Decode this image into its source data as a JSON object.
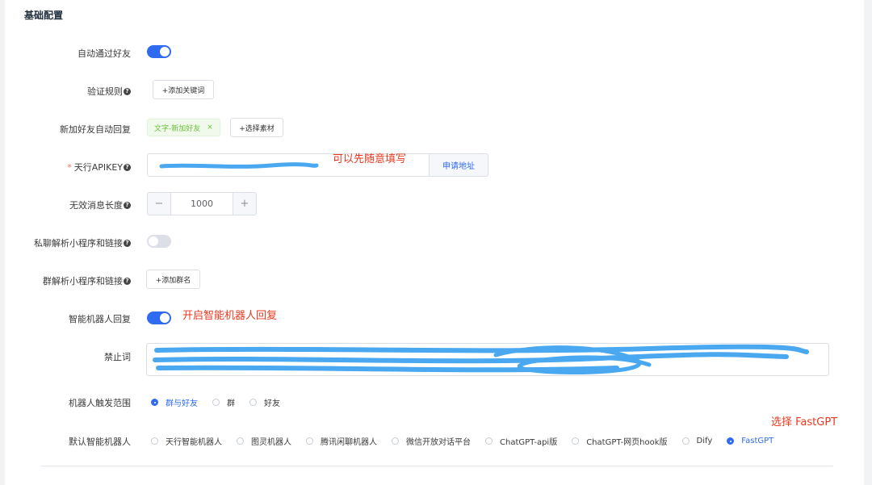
{
  "section_title": "基础配置",
  "auto_accept": {
    "label": "自动通过好友",
    "enabled": true
  },
  "verify_rule": {
    "label": "验证规则",
    "add_button": "+添加关键词"
  },
  "new_friend_reply": {
    "label": "新加好友自动回复",
    "tag": "文字-新加好友",
    "tag_close": "×",
    "select_button": "+选择素材"
  },
  "apikey": {
    "required_mark": "*",
    "label": "天行APIKEY",
    "value": "",
    "apply_button": "申请地址",
    "annotation": "可以先随意填写"
  },
  "invalid_length": {
    "label": "无效消息长度",
    "value": "1000",
    "minus": "−",
    "plus": "+"
  },
  "private_parse": {
    "label": "私聊解析小程序和链接",
    "enabled": false
  },
  "group_parse": {
    "label": "群解析小程序和链接",
    "add_button": "+添加群名"
  },
  "smart_reply": {
    "label": "智能机器人回复",
    "enabled": true,
    "annotation": "开启智能机器人回复"
  },
  "forbidden_words": {
    "label": "禁止词",
    "value": ""
  },
  "trigger_scope": {
    "label": "机器人触发范围",
    "options": [
      "群与好友",
      "群",
      "好友"
    ],
    "selected": "群与好友"
  },
  "default_bot": {
    "label": "默认智能机器人",
    "options": [
      "天行智能机器人",
      "图灵机器人",
      "腾讯闲聊机器人",
      "微信开放对话平台",
      "ChatGPT-api版",
      "ChatGPT-网页hook版",
      "Dify",
      "FastGPT"
    ],
    "selected": "FastGPT",
    "annotation": "选择 FastGPT"
  },
  "colors": {
    "primary": "#2f6bf0",
    "annotation": "#e8391f",
    "scribble": "#4aa8f0"
  }
}
